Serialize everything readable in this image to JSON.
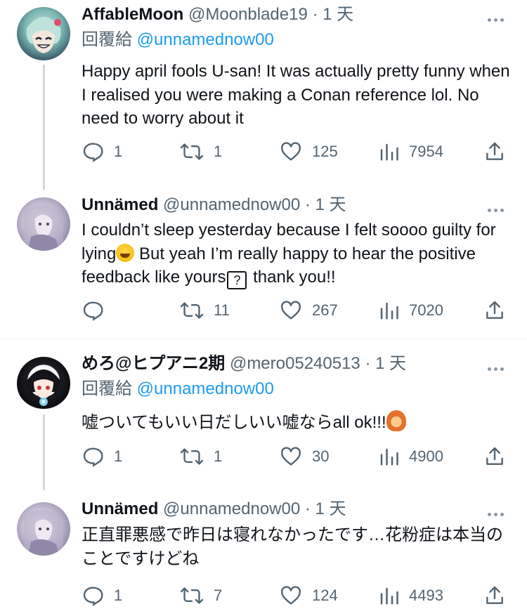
{
  "tweets": [
    {
      "name": "AffableMoon",
      "handle": "@Moonblade19",
      "time": "1 天",
      "reply_prefix": "回覆給",
      "reply_to": "@unnamednow00",
      "text": "Happy april fools U-san! It was actually pretty funny when I realised you were making a Conan reference lol. No need to worry about it",
      "replies": "1",
      "retweets": "1",
      "likes": "125",
      "views": "7954"
    },
    {
      "name": "Unnämed",
      "handle": "@unnamednow00",
      "time": "1 天",
      "text_parts": [
        "I couldn’t sleep yesterday because I felt soooo guilty for lying",
        " But yeah I’m really happy to hear the positive feedback like yours",
        " thank you!!"
      ],
      "emoji_2": "?",
      "replies": "",
      "retweets": "11",
      "likes": "267",
      "views": "7020"
    },
    {
      "name": "めろ@ヒプアニ2期",
      "handle": "@mero05240513",
      "time": "1 天",
      "reply_prefix": "回覆給",
      "reply_to": "@unnamednow00",
      "text": "嘘ついてもいい日だしいい嘘ならall ok!!!",
      "replies": "1",
      "retweets": "1",
      "likes": "30",
      "views": "4900"
    },
    {
      "name": "Unnämed",
      "handle": "@unnamednow00",
      "time": "1 天",
      "text": "正直罪悪感で昨日は寝れなかったです…花粉症は本当のことですけどね",
      "replies": "1",
      "retweets": "7",
      "likes": "124",
      "views": "4493"
    }
  ],
  "separator_dot": "·",
  "icons": {
    "reply": "speech-bubble-icon",
    "retweet": "retweet-arrows-icon",
    "like": "heart-outline-icon",
    "views": "bar-chart-icon",
    "share": "share-upload-icon",
    "more": "more-dots-icon"
  },
  "colors": {
    "link": "#1d9bf0",
    "muted": "#536471",
    "text": "#0f1419",
    "thread": "#cfd9de"
  }
}
